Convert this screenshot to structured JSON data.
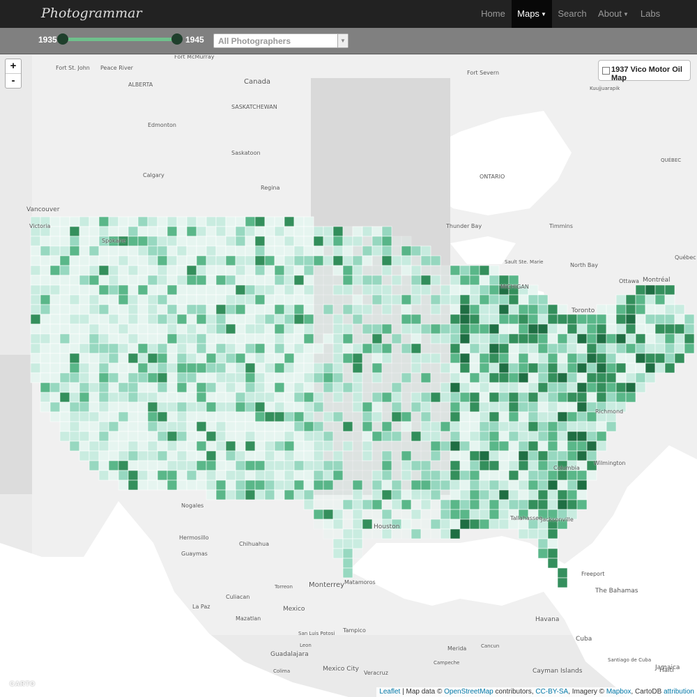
{
  "navbar": {
    "brand": "Photogrammar",
    "items": [
      {
        "label": "Home"
      },
      {
        "label": "Maps"
      },
      {
        "label": "Search"
      },
      {
        "label": "About"
      },
      {
        "label": "Labs"
      }
    ],
    "active": "Maps"
  },
  "filters": {
    "year_start": "1935",
    "year_end": "1945",
    "photographer": "All Photographers"
  },
  "map": {
    "zoom_in": "+",
    "zoom_out": "-",
    "overlay_label": "1937 Vico Motor Oil Map",
    "overlay_checked": false,
    "carto_logo": "CARTO",
    "labels": [
      {
        "text": "Fort St. John"
      },
      {
        "text": "Peace River"
      },
      {
        "text": "Fort McMurray"
      },
      {
        "text": "ALBERTA"
      },
      {
        "text": "Canada"
      },
      {
        "text": "SASKATCHEWAN"
      },
      {
        "text": "Edmonton"
      },
      {
        "text": "Saskatoon"
      },
      {
        "text": "Calgary"
      },
      {
        "text": "Regina"
      },
      {
        "text": "Vancouver"
      },
      {
        "text": "Victoria"
      },
      {
        "text": "Spokane"
      },
      {
        "text": "Fort Severn"
      },
      {
        "text": "Kuujjuarapik"
      },
      {
        "text": "ONTARIO"
      },
      {
        "text": "QUÉBEC"
      },
      {
        "text": "Thunder Bay"
      },
      {
        "text": "Timmins"
      },
      {
        "text": "Sault Ste. Marie"
      },
      {
        "text": "North Bay"
      },
      {
        "text": "MICHIGAN"
      },
      {
        "text": "Ottawa"
      },
      {
        "text": "Montréal"
      },
      {
        "text": "Québec"
      },
      {
        "text": "Toronto"
      },
      {
        "text": "Nogales"
      },
      {
        "text": "Hermosillo"
      },
      {
        "text": "Chihuahua"
      },
      {
        "text": "Guaymas"
      },
      {
        "text": "Monterrey"
      },
      {
        "text": "Torreon"
      },
      {
        "text": "Culiacan"
      },
      {
        "text": "La Paz"
      },
      {
        "text": "Mazatlan"
      },
      {
        "text": "Mexico"
      },
      {
        "text": "San Luis Potosi"
      },
      {
        "text": "Tampico"
      },
      {
        "text": "Guadalajara"
      },
      {
        "text": "Leon"
      },
      {
        "text": "Colima"
      },
      {
        "text": "Mexico City"
      },
      {
        "text": "Veracruz"
      },
      {
        "text": "Merida"
      },
      {
        "text": "Cancun"
      },
      {
        "text": "Campeche"
      },
      {
        "text": "Havana"
      },
      {
        "text": "Cuba"
      },
      {
        "text": "The Bahamas"
      },
      {
        "text": "Freeport"
      },
      {
        "text": "Cayman Islands"
      },
      {
        "text": "Santiago de Cuba"
      },
      {
        "text": "Jamaica"
      },
      {
        "text": "Haiti"
      },
      {
        "text": "Houston"
      },
      {
        "text": "Tallahassee"
      },
      {
        "text": "Jacksonville"
      },
      {
        "text": "Matamoros"
      },
      {
        "text": "Richmond"
      },
      {
        "text": "Columbia"
      },
      {
        "text": "Wilmington"
      }
    ]
  },
  "attribution": {
    "leaflet": "Leaflet",
    "sep1": " | Map data © ",
    "osm": "OpenStreetMap",
    "contrib": " contributors, ",
    "ccbysa": "CC-BY-SA",
    "imagery": ", Imagery © ",
    "mapbox": "Mapbox",
    "carto": ", CartoDB ",
    "attrib": "attribution"
  },
  "colors": {
    "navbar_bg": "#222222",
    "toolbar_bg": "#808080",
    "slider_fill": "#6fc08c",
    "choropleth": [
      "#e6f6f1",
      "#c7ece0",
      "#93d7be",
      "#52b484",
      "#2a8a55",
      "#14683a"
    ]
  }
}
